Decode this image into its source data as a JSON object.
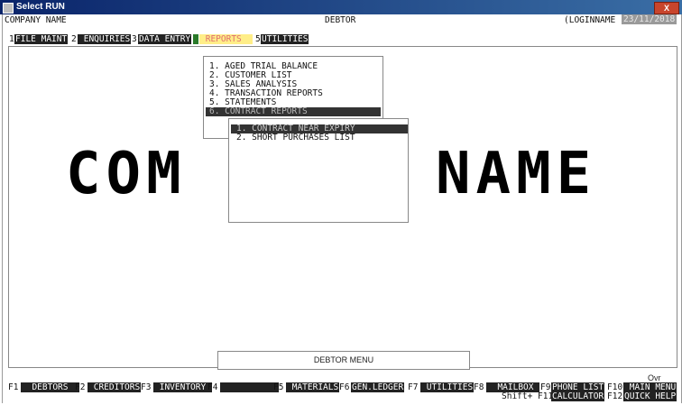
{
  "window": {
    "title": "Select RUN",
    "close_symbol": "X"
  },
  "header": {
    "company": "COMPANY NAME",
    "module": "DEBTOR",
    "login": "(LOGINNAME )",
    "date": "23/11/2018"
  },
  "menubar": [
    {
      "num": "1",
      "label": "FILE MAINT"
    },
    {
      "num": "2",
      "label": " ENQUIRIES"
    },
    {
      "num": "3",
      "label": "DATA ENTRY"
    },
    {
      "num": "4",
      "label": " REPORTS  "
    },
    {
      "num": "5",
      "label": "UTILITIES"
    }
  ],
  "banner": {
    "left": "COM",
    "right": "NAME"
  },
  "reports_menu": [
    "1. AGED TRIAL BALANCE",
    "2. CUSTOMER LIST",
    "3. SALES ANALYSIS",
    "4. TRANSACTION REPORTS",
    "5. STATEMENTS",
    "6. CONTRACT REPORTS"
  ],
  "contract_menu": [
    "1. CONTRACT NEAR EXPIRY",
    "2. SHORT PURCHASES LIST"
  ],
  "status": {
    "menu_title": "DEBTOR MENU",
    "ovr": "Ovr"
  },
  "fkeys": [
    {
      "key": "F1",
      "label": "  DEBTORS  "
    },
    {
      "key": "F2",
      "label": " CREDITORS"
    },
    {
      "key": "F3",
      "label": " INVENTORY "
    },
    {
      "key": "F4",
      "label": "           "
    },
    {
      "key": "F5",
      "label": " MATERIALS"
    },
    {
      "key": "F6",
      "label": "GEN.LEDGER"
    },
    {
      "key": "F7",
      "label": " UTILITIES"
    },
    {
      "key": "F8",
      "label": "  MAILBOX "
    },
    {
      "key": "F9",
      "label": "PHONE LIST"
    },
    {
      "key": "F10",
      "label": " MAIN MENU"
    }
  ],
  "shift_row": {
    "prefix": "Shift+ F11",
    "f11_label": "CALCULATOR",
    "f12_key": "F12",
    "f12_label": "QUICK HELP"
  }
}
